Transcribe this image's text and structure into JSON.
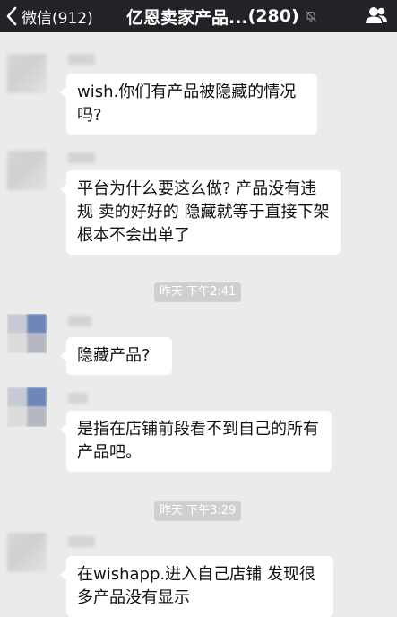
{
  "navbar": {
    "back_label": "微信(912)",
    "title": "亿恩卖家产品...",
    "member_count": "(280)"
  },
  "messages": [
    {
      "text": "wish.你们有产品被隐藏的情况吗?"
    },
    {
      "text": "平台为什么要这么做? 产品没有违规 卖的好好的 隐藏就等于直接下架 根本不会出单了"
    },
    {
      "text": "隐藏产品?"
    },
    {
      "text": "是指在店铺前段看不到自己的所有产品吧。"
    },
    {
      "text": "在wishapp.进入自己店铺 发现很多产品没有显示"
    }
  ],
  "timestamps": [
    {
      "label": "昨天 下午2:41"
    },
    {
      "label": "昨天 下午3:29"
    }
  ],
  "icons": {
    "back": "chevron-left-icon",
    "mute": "bell-muted-icon",
    "contacts": "group-members-icon"
  },
  "colors": {
    "navbar_bg": "#222326",
    "chat_bg": "#ebebeb",
    "bubble_bg": "#ffffff",
    "timestamp_bg": "#cfcfcf"
  }
}
